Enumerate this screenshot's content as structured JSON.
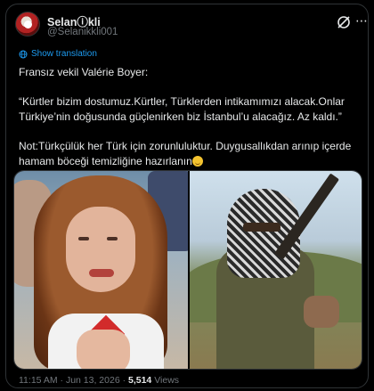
{
  "author": {
    "display_name": "Selanⓘkli",
    "handle": "@Selanikkli001"
  },
  "translate_label": "Show translation",
  "post": {
    "line1": "Fransız vekil Valérie Boyer:",
    "line2": "“Kürtler bizim dostumuz.Kürtler, Türklerden intikamımızı alacak.Onlar Türkiye’nin doğusunda güçlenirken biz İstanbul’u alacağız. Az kaldı.”",
    "line3": "Not:Türkçülük her Türk için zorunluluktur. Duygusallıkdan arınıp içerde hamam böceği temizliğine hazırlanın"
  },
  "footer": {
    "time": "11:15 AM",
    "sep": " · ",
    "date": "Jun 13, 2026",
    "views": "5,514",
    "views_label": "Views"
  },
  "icons": {
    "grok": "grok-icon",
    "more": "more-icon",
    "translate": "globe-icon"
  },
  "colors": {
    "accent": "#1d9bf0",
    "text": "#e7e9ea",
    "muted": "#71767b",
    "background": "#000000",
    "border": "#2f3336"
  }
}
